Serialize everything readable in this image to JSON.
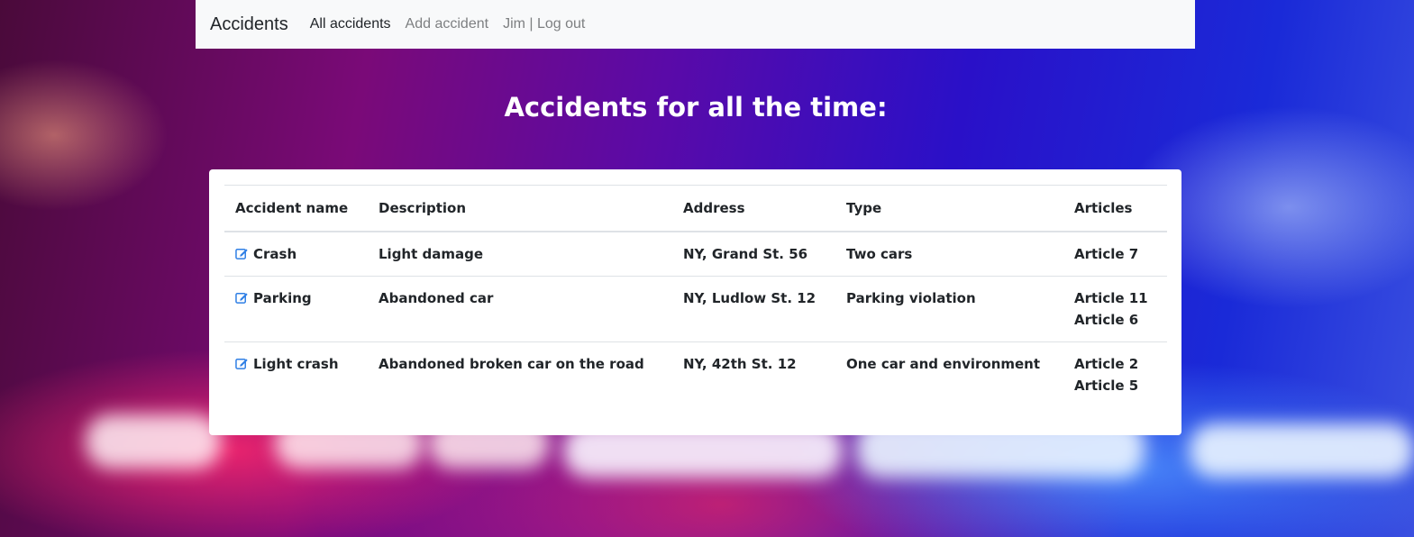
{
  "nav": {
    "brand": "Accidents",
    "links": [
      "All accidents",
      "Add accident",
      "Jim | Log out"
    ]
  },
  "page_title": "Accidents for all the time:",
  "table": {
    "headers": [
      "Accident name",
      "Description",
      "Address",
      "Type",
      "Articles"
    ],
    "rows": [
      {
        "name": "Crash",
        "description": "Light damage",
        "address": "NY, Grand St. 56",
        "type": "Two cars",
        "articles": [
          "Article 7"
        ]
      },
      {
        "name": "Parking",
        "description": "Abandoned car",
        "address": "NY, Ludlow St. 12",
        "type": "Parking violation",
        "articles": [
          "Article 11",
          "Article 6"
        ]
      },
      {
        "name": "Light crash",
        "description": "Abandoned broken car on the road",
        "address": "NY, 42th St. 12",
        "type": "One car and environment",
        "articles": [
          "Article 2",
          "Article 5"
        ]
      }
    ],
    "row_icon": "edit-icon"
  },
  "colors": {
    "icon": "#2f7fe5",
    "navbar_bg": "#f8f9fa",
    "nav_inactive": "#7d7f81"
  }
}
